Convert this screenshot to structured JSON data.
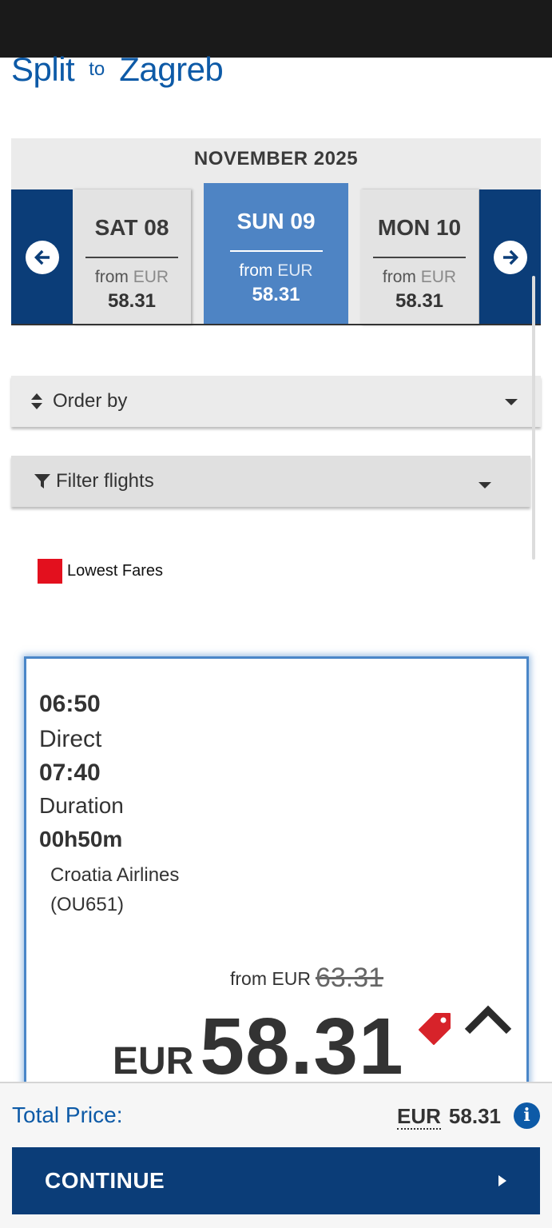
{
  "route": {
    "origin": "Split",
    "connector": "to",
    "destination": "Zagreb"
  },
  "calendar": {
    "month": "NOVEMBER 2025",
    "days": [
      {
        "label": "SAT 08",
        "from": "from",
        "currency": "EUR",
        "price": "58.31",
        "selected": false
      },
      {
        "label": "SUN 09",
        "from": "from",
        "currency": "EUR",
        "price": "58.31",
        "selected": true
      },
      {
        "label": "MON 10",
        "from": "from",
        "currency": "EUR",
        "price": "58.31",
        "selected": false
      }
    ],
    "prev_icon": "arrow-left-circle-icon",
    "next_icon": "arrow-right-circle-icon"
  },
  "order_by": {
    "label": "Order by",
    "icon": "sort-icon"
  },
  "filter": {
    "label": "Filter flights",
    "icon": "filter-icon"
  },
  "legend": {
    "label": "Lowest Fares",
    "color": "#e3101e"
  },
  "flight": {
    "departure": "06:50",
    "stops": "Direct",
    "arrival": "07:40",
    "duration_label": "Duration",
    "duration": "00h50m",
    "airline": "Croatia Airlines",
    "flight_no": "(OU651)",
    "from_text": "from EUR",
    "old_price": "63.31",
    "currency": "EUR",
    "price": "58.31",
    "tag_icon": "price-tag-icon",
    "collapse_icon": "chevron-up-icon"
  },
  "footer": {
    "total_label": "Total Price:",
    "currency": "EUR",
    "total": "58.31",
    "info_icon": "info-icon",
    "continue_label": "CONTINUE"
  },
  "colors": {
    "brand_blue": "#0d5aa7",
    "navy": "#0b3d78",
    "selected_day": "#4e84c4",
    "lowest_fare_red": "#e3101e"
  }
}
